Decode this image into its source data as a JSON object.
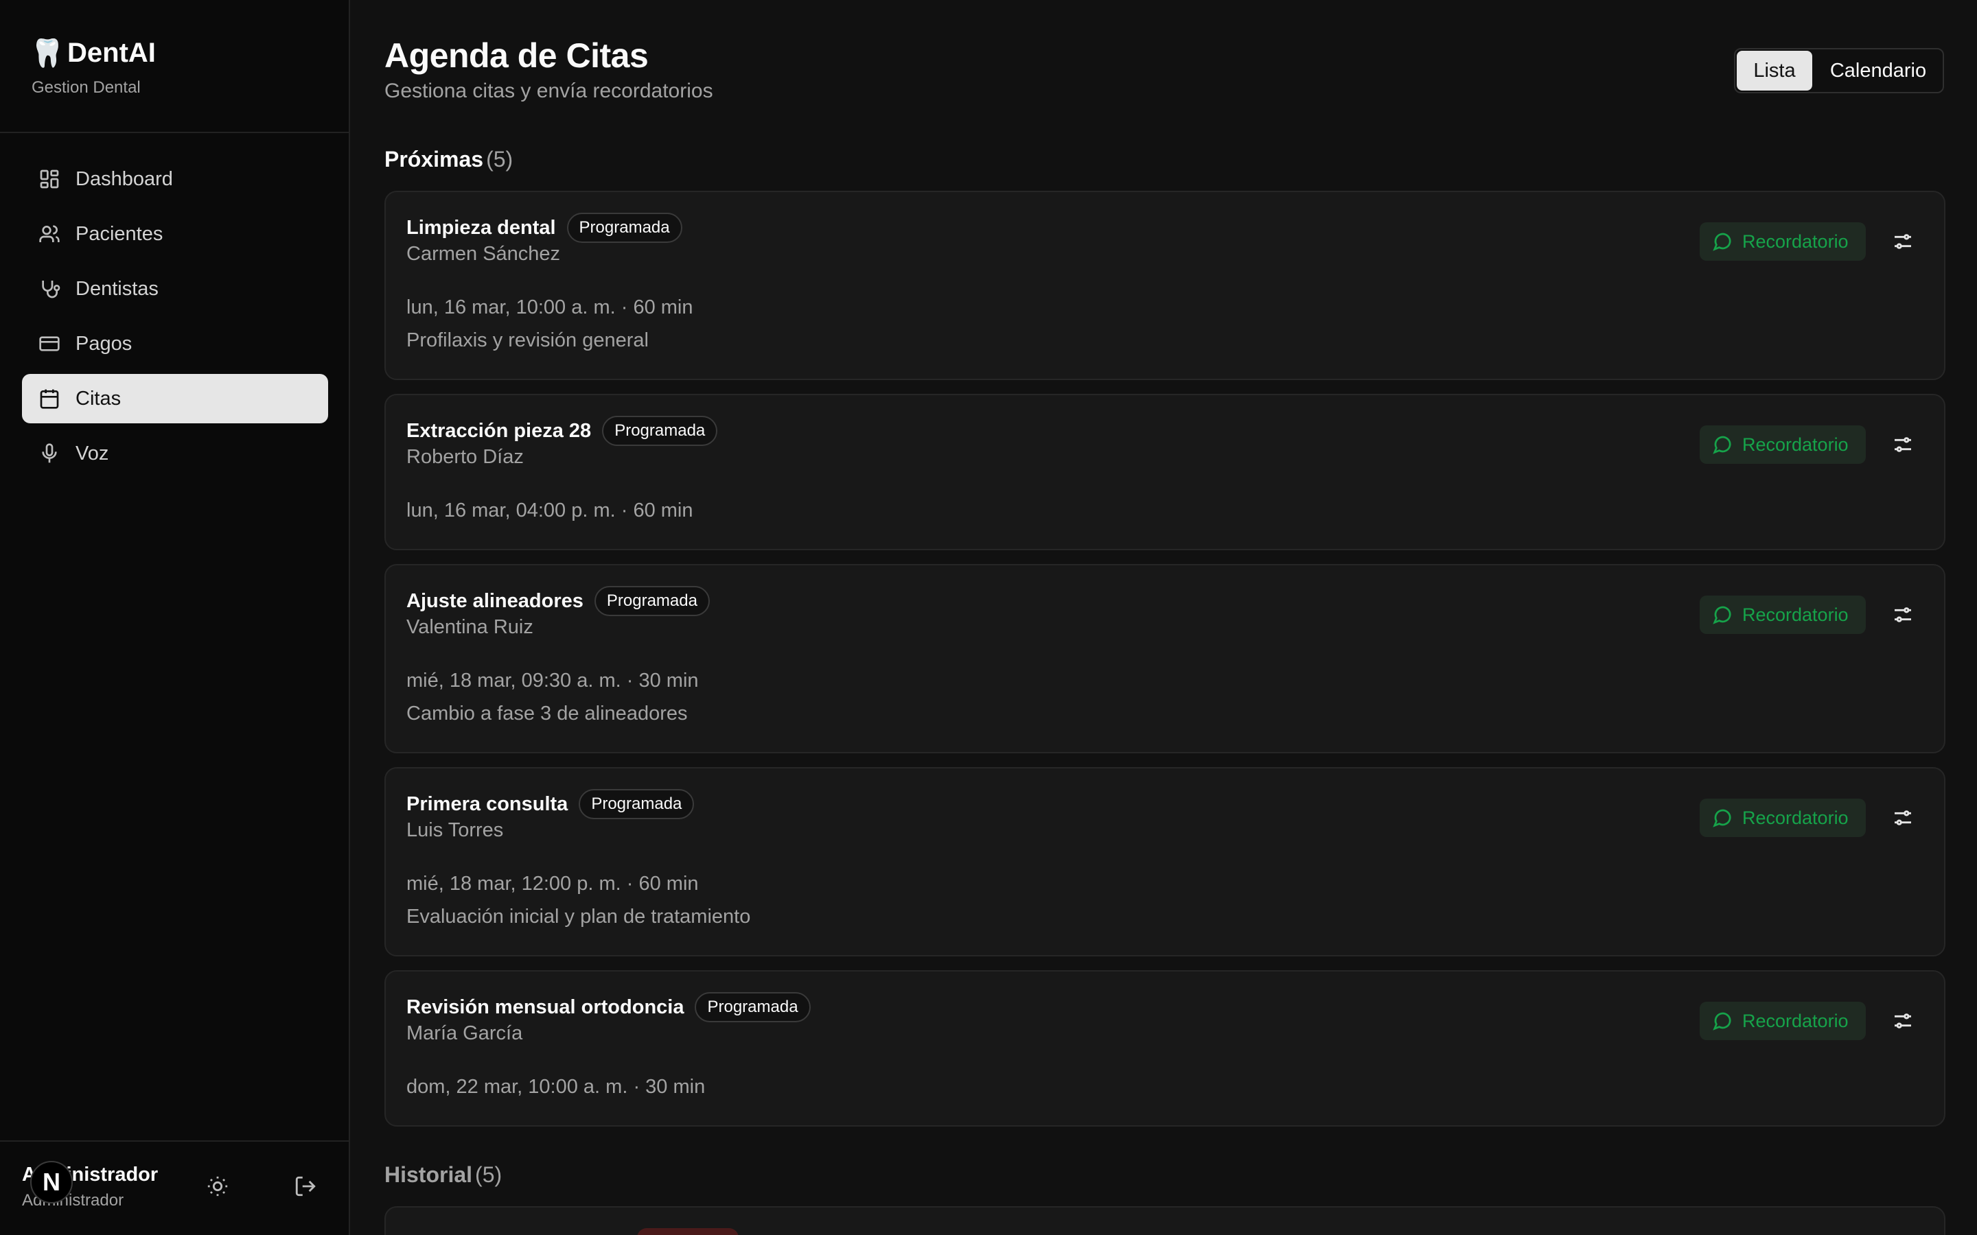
{
  "brand": {
    "title": "DentAI",
    "subtitle": "Gestion Dental",
    "logo_glyph": "🦷"
  },
  "nav": {
    "items": [
      {
        "label": "Dashboard",
        "icon": "dashboard-icon",
        "active": false
      },
      {
        "label": "Pacientes",
        "icon": "users-icon",
        "active": false
      },
      {
        "label": "Dentistas",
        "icon": "stethoscope-icon",
        "active": false
      },
      {
        "label": "Pagos",
        "icon": "credit-card-icon",
        "active": false
      },
      {
        "label": "Citas",
        "icon": "calendar-icon",
        "active": true
      },
      {
        "label": "Voz",
        "icon": "mic-icon",
        "active": false
      }
    ]
  },
  "user": {
    "name": "Administrador",
    "role": "Administrador",
    "avatar_letter": "N"
  },
  "page": {
    "title": "Agenda de Citas",
    "subtitle": "Gestiona citas y envía recordatorios"
  },
  "view_toggle": {
    "list_label": "Lista",
    "calendar_label": "Calendario",
    "selected": "Lista"
  },
  "upcoming": {
    "title": "Próximas",
    "count": "(5)",
    "appointments": [
      {
        "title": "Limpieza dental",
        "status": "Programada",
        "patient": "Carmen Sánchez",
        "when": "lun, 16 mar, 10:00 a. m. · 60 min",
        "note": "Profilaxis y revisión general",
        "reminder_label": "Recordatorio"
      },
      {
        "title": "Extracción pieza 28",
        "status": "Programada",
        "patient": "Roberto Díaz",
        "when": "lun, 16 mar, 04:00 p. m. · 60 min",
        "note": "",
        "reminder_label": "Recordatorio"
      },
      {
        "title": "Ajuste alineadores",
        "status": "Programada",
        "patient": "Valentina Ruiz",
        "when": "mié, 18 mar, 09:30 a. m. · 30 min",
        "note": "Cambio a fase 3 de alineadores",
        "reminder_label": "Recordatorio"
      },
      {
        "title": "Primera consulta",
        "status": "Programada",
        "patient": "Luis Torres",
        "when": "mié, 18 mar, 12:00 p. m. · 60 min",
        "note": "Evaluación inicial y plan de tratamiento",
        "reminder_label": "Recordatorio"
      },
      {
        "title": "Revisión mensual ortodoncia",
        "status": "Programada",
        "patient": "María García",
        "when": "dom, 22 mar, 10:00 a. m. · 30 min",
        "note": "",
        "reminder_label": "Recordatorio"
      }
    ]
  },
  "history": {
    "title": "Historial",
    "count": "(5)"
  },
  "colors": {
    "accent_green": "#16a34a",
    "background": "#111111",
    "sidebar": "#0a0a0a",
    "card": "#181818"
  }
}
